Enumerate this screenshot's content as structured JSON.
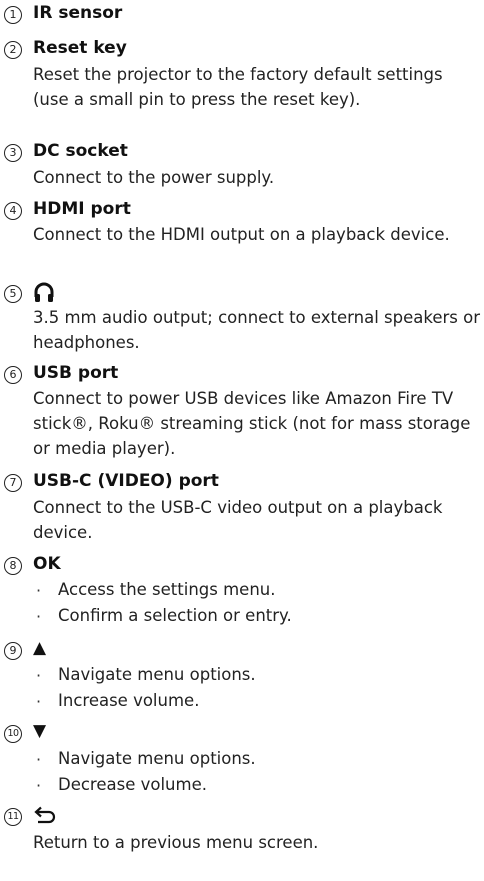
{
  "items": [
    {
      "num": "1",
      "title": "IR sensor"
    },
    {
      "num": "2",
      "title": "Reset key",
      "desc": "Reset the projector to the factory default settings (use a small pin to press the reset key)."
    },
    {
      "num": "3",
      "title": "DC socket",
      "desc": "Connect to the power supply."
    },
    {
      "num": "4",
      "title": "HDMI port",
      "desc": "Connect to the HDMI output on a playback device."
    },
    {
      "num": "5",
      "icon": "headphones-icon",
      "desc": "3.5 mm audio output; connect to external speakers or headphones."
    },
    {
      "num": "6",
      "title": "USB port",
      "desc": "Connect to power USB devices like Amazon Fire TV stick®, Roku® streaming stick (not for mass storage or media player)."
    },
    {
      "num": "7",
      "title": "USB-C (VIDEO) port",
      "desc": "Connect to the USB-C video output on a playback device."
    },
    {
      "num": "8",
      "title": "OK",
      "bullets": [
        "Access the settings menu.",
        "Confirm a selection or entry."
      ]
    },
    {
      "num": "9",
      "title": "▲",
      "bullets": [
        "Navigate menu options.",
        "Increase volume."
      ]
    },
    {
      "num": "10",
      "title": "▼",
      "bullets": [
        "Navigate menu options.",
        "Decrease volume."
      ]
    },
    {
      "num": "11",
      "icon": "return-arrow-icon",
      "desc": "Return to a previous menu screen."
    }
  ],
  "bullet_char": "·"
}
